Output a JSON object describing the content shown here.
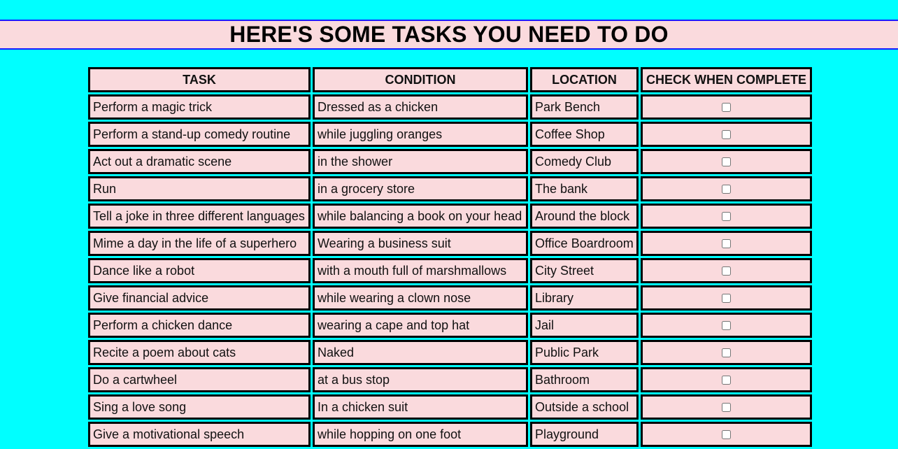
{
  "page": {
    "heading": "HERE'S SOME TASKS YOU NEED TO DO"
  },
  "colors": {
    "background": "#00ffff",
    "cell_background": "#fadadd",
    "banner_border": "#1a1aff",
    "cell_border": "#000000"
  },
  "table": {
    "headers": [
      "TASK",
      "CONDITION",
      "LOCATION",
      "CHECK WHEN COMPLETE"
    ],
    "rows": [
      {
        "task": "Perform a magic trick",
        "condition": "Dressed as a chicken",
        "location": "Park Bench",
        "checked": false
      },
      {
        "task": "Perform a stand-up comedy routine",
        "condition": "while juggling oranges",
        "location": "Coffee Shop",
        "checked": false
      },
      {
        "task": "Act out a dramatic scene",
        "condition": "in the shower",
        "location": "Comedy Club",
        "checked": false
      },
      {
        "task": "Run",
        "condition": "in a grocery store",
        "location": "The bank",
        "checked": false
      },
      {
        "task": "Tell a joke in three different languages",
        "condition": "while balancing a book on your head",
        "location": "Around the block",
        "checked": false
      },
      {
        "task": "Mime a day in the life of a superhero",
        "condition": "Wearing a business suit",
        "location": "Office Boardroom",
        "checked": false
      },
      {
        "task": "Dance like a robot",
        "condition": "with a mouth full of marshmallows",
        "location": "City Street",
        "checked": false
      },
      {
        "task": "Give financial advice",
        "condition": "while wearing a clown nose",
        "location": "Library",
        "checked": false
      },
      {
        "task": "Perform a chicken dance",
        "condition": "wearing a cape and top hat",
        "location": "Jail",
        "checked": false
      },
      {
        "task": "Recite a poem about cats",
        "condition": "Naked",
        "location": "Public Park",
        "checked": false
      },
      {
        "task": "Do a cartwheel",
        "condition": "at a bus stop",
        "location": "Bathroom",
        "checked": false
      },
      {
        "task": "Sing a love song",
        "condition": "In a chicken suit",
        "location": "Outside a school",
        "checked": false
      },
      {
        "task": "Give a motivational speech",
        "condition": "while hopping on one foot",
        "location": "Playground",
        "checked": false
      }
    ]
  }
}
